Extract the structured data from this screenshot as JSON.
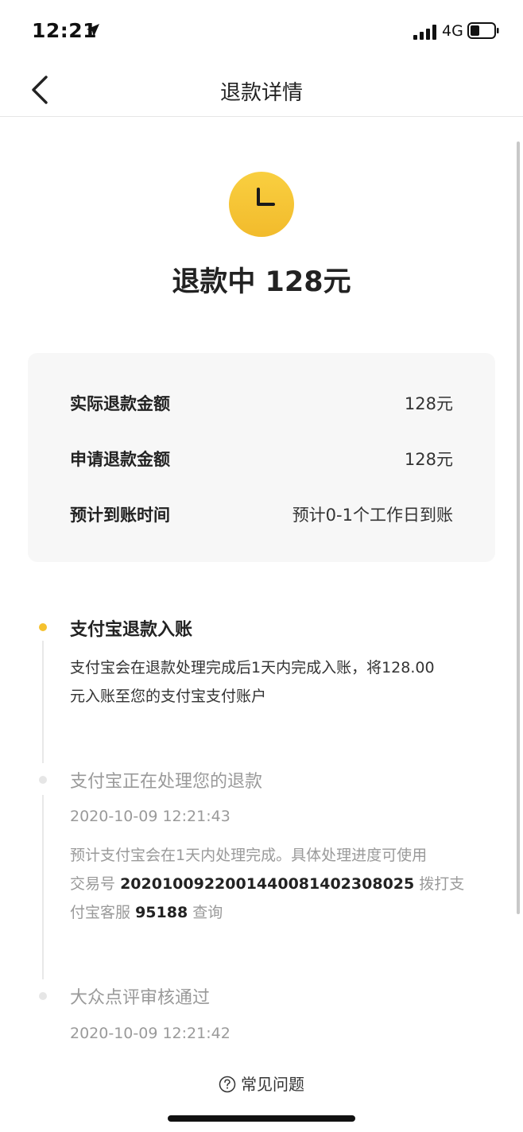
{
  "status_bar": {
    "time": "12:21",
    "network": "4G",
    "icons": [
      "location-arrow-icon",
      "signal-icon",
      "battery-icon"
    ]
  },
  "nav": {
    "title": "退款详情",
    "back_icon": "chevron-left-icon"
  },
  "header": {
    "icon": "clock-icon",
    "icon_color": "#f5c12e",
    "status": "退款中 128元"
  },
  "details": [
    {
      "label": "实际退款金额",
      "value": "128元"
    },
    {
      "label": "申请退款金额",
      "value": "128元"
    },
    {
      "label": "预计到账时间",
      "value": "预计0-1个工作日到账"
    }
  ],
  "timeline": [
    {
      "title": "支付宝退款入账",
      "line1": "支付宝会在退款处理完成后1天内完成入账，将128.00",
      "line2": "元入账至您的支付宝支付账户"
    },
    {
      "title": "支付宝正在处理您的退款",
      "date": "2020-10-09 12:21:43",
      "line1": "预计支付宝会在1天内处理完成。具体处理进度可使用",
      "line2_prefix": "交易号",
      "trade_no": "2020100922001440081402308025",
      "line2_suffix": "拨打支",
      "line3_prefix": "付宝客服",
      "hotline": "95188",
      "line3_suffix": "查询"
    },
    {
      "title": "大众点评审核通过",
      "date": "2020-10-09 12:21:42"
    }
  ],
  "faq": {
    "label": "常见问题",
    "icon": "question-circle-icon"
  },
  "colors": {
    "accent": "#f5c12e",
    "muted": "#9a9a9a"
  }
}
